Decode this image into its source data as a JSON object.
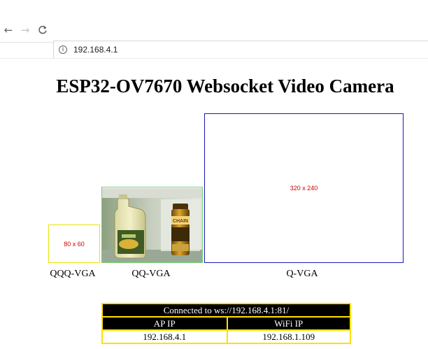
{
  "browser": {
    "url": "192.168.4.1",
    "nav": {
      "back": "←",
      "forward": "→",
      "reload": "C"
    },
    "info_icon": "ⓘ"
  },
  "page": {
    "title": "ESP32-OV7670 Websocket Video Camera",
    "canvases": [
      {
        "label": "QQQ-VGA",
        "placeholder": "80 x 60",
        "border_color": "#e8e400"
      },
      {
        "label": "QQ-VGA",
        "placeholder": "",
        "border_color": "#6ed46e"
      },
      {
        "label": "Q-VGA",
        "placeholder": "320 x 240",
        "border_color": "#1a1ab8"
      }
    ],
    "status": {
      "connection": "Connected to ws://192.168.4.1:81/",
      "headers": [
        "AP IP",
        "WiFi IP"
      ],
      "values": [
        "192.168.4.1",
        "192.168.1.109"
      ]
    }
  },
  "colors": {
    "placeholder_text": "#cc0000",
    "table_border": "#ffe000",
    "header_bg": "#000000"
  }
}
